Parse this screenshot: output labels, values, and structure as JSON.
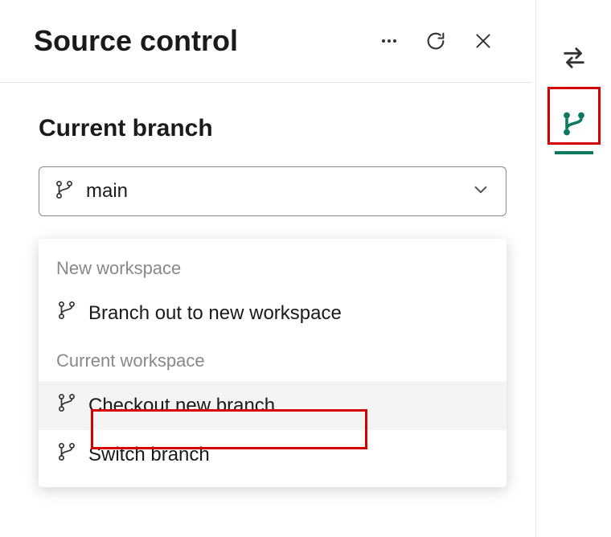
{
  "header": {
    "title": "Source control"
  },
  "section": {
    "current_branch_label": "Current branch",
    "selected_branch": "main"
  },
  "dropdown": {
    "group_new": "New workspace",
    "item_branch_out": "Branch out to new workspace",
    "group_current": "Current workspace",
    "item_checkout": "Checkout new branch",
    "item_switch": "Switch branch"
  }
}
